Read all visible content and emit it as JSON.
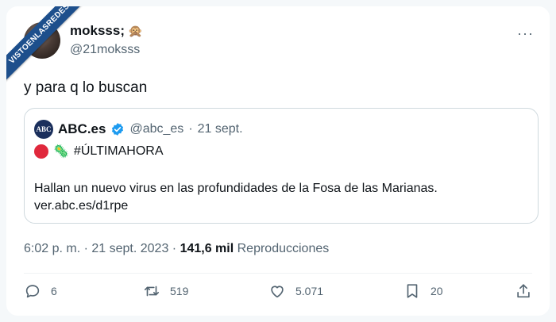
{
  "watermark": "VISTOENLASREDES",
  "author": {
    "name": "moksss;",
    "emoji": "🙊",
    "handle": "@21moksss"
  },
  "more_label": "···",
  "tweet_text": "y para q lo buscan",
  "quote": {
    "logo_text": "ABC",
    "name": "ABC.es",
    "handle": "@abc_es",
    "separator": "·",
    "date": "21 sept.",
    "emoji_virus": "🦠",
    "hashtag": "#ÚLTIMAHORA",
    "body_line1": "Hallan un nuevo virus en las profundidades de la Fosa de las Marianas.",
    "body_line2": "ver.abc.es/d1rpe"
  },
  "meta": {
    "time_date": "6:02 p. m. · 21 sept. 2023 ·",
    "views_count": "141,6 mil",
    "views_label": "Reproducciones"
  },
  "actions": {
    "replies": "6",
    "retweets": "519",
    "likes": "5.071",
    "bookmarks": "20"
  },
  "colors": {
    "accent": "#1d9bf0",
    "muted": "#536471",
    "badge_red": "#e0283c"
  }
}
